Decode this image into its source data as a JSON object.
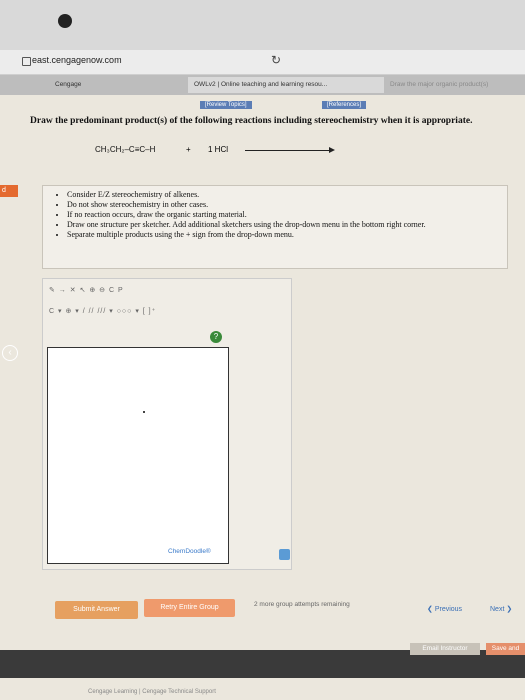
{
  "browser": {
    "url": "east.cengagenow.com",
    "tabs": [
      "Cengage",
      "OWLv2 | Online teaching and learning resou...",
      "Draw the major organic product(s)"
    ]
  },
  "links": {
    "review_topics": "[Review Topics]",
    "references": "[References]"
  },
  "question": {
    "instruction": "Draw the predominant product(s) of the following reactions including stereochemistry when it is appropriate.",
    "reactant": "CH₃CH₂–C≡C–H",
    "plus": "+",
    "reagent": "1 HCl"
  },
  "left_tag": "d",
  "notes": [
    "Consider E/Z stereochemistry of alkenes.",
    "Do not show stereochemistry in other cases.",
    "If no reaction occurs, draw the organic starting material.",
    "Draw one structure per sketcher. Add additional sketchers using the drop-down menu in the bottom right corner.",
    "Separate multiple products using the + sign from the drop-down menu."
  ],
  "sketcher": {
    "toolbar1": "✎ → ✕ ↖ ⊕ ⊖  C  P",
    "toolbar2": "C ▾ ⊕ ▾  / // /// ▾  ○○○ ▾  [ ]⁺",
    "help": "?",
    "brand": "ChemDoodle®"
  },
  "controls": {
    "submit": "Submit Answer",
    "retry": "Retry Entire Group",
    "attempts": "2 more group attempts remaining",
    "previous": "Previous",
    "next": "Next",
    "email": "Email Instructor",
    "save": "Save and"
  },
  "footer": "Cengage Learning  |  Cengage Technical Support"
}
